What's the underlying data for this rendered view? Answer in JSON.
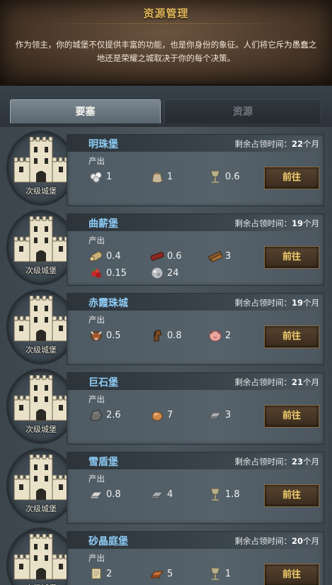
{
  "header": {
    "title": "资源管理",
    "description": "作为领主，你的城堡不仅提供丰富的功能，也是你身份的象征。人们将它斥为愚蠢之地还是荣耀之城取决于你的每个决策。"
  },
  "tabs": [
    {
      "label": "要塞",
      "active": true
    },
    {
      "label": "资源",
      "active": false
    }
  ],
  "labels": {
    "remaining_prefix": "剩余占领时间：",
    "produce": "产出",
    "go": "前往"
  },
  "castles": [
    {
      "name": "明珠堡",
      "rank": "次级城堡",
      "remaining_value": "22",
      "remaining_unit": "个月",
      "resources": [
        {
          "icon": "pearl-icon",
          "value": "1"
        },
        {
          "icon": "sack-icon",
          "value": "1"
        },
        {
          "icon": "goblet-icon",
          "value": "0.6"
        }
      ]
    },
    {
      "name": "曲薪堡",
      "rank": "次级城堡",
      "remaining_value": "19",
      "remaining_unit": "个月",
      "resources": [
        {
          "icon": "log-icon",
          "value": "0.4"
        },
        {
          "icon": "red-wood-icon",
          "value": "0.6"
        },
        {
          "icon": "plank-icon",
          "value": "3"
        },
        {
          "icon": "berry-icon",
          "value": "0.15"
        },
        {
          "icon": "silver-ore-icon",
          "value": "24"
        }
      ]
    },
    {
      "name": "赤霞珠城",
      "rank": "次级城堡",
      "remaining_value": "19",
      "remaining_unit": "个月",
      "resources": [
        {
          "icon": "cow-icon",
          "value": "0.5"
        },
        {
          "icon": "horse-icon",
          "value": "0.8"
        },
        {
          "icon": "pig-icon",
          "value": "2"
        }
      ]
    },
    {
      "name": "巨石堡",
      "rank": "次级城堡",
      "remaining_value": "21",
      "remaining_unit": "个月",
      "resources": [
        {
          "icon": "stone-icon",
          "value": "2.6"
        },
        {
          "icon": "clay-icon",
          "value": "7"
        },
        {
          "icon": "iron-ingot-icon",
          "value": "3"
        }
      ]
    },
    {
      "name": "雪盾堡",
      "rank": "次级城堡",
      "remaining_value": "23",
      "remaining_unit": "个月",
      "resources": [
        {
          "icon": "silver-ingot-icon",
          "value": "0.8"
        },
        {
          "icon": "iron-ingot-icon",
          "value": "4"
        },
        {
          "icon": "goblet-icon",
          "value": "1.8"
        }
      ]
    },
    {
      "name": "砂晶庭堡",
      "rank": "次级城堡",
      "remaining_value": "20",
      "remaining_unit": "个月",
      "resources": [
        {
          "icon": "scroll-icon",
          "value": "2"
        },
        {
          "icon": "copper-ingot-icon",
          "value": "5"
        },
        {
          "icon": "goblet-icon",
          "value": "1"
        }
      ]
    }
  ]
}
